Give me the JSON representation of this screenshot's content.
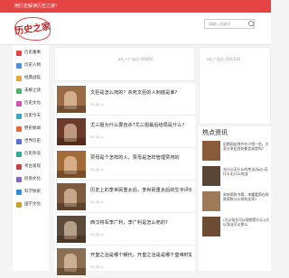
{
  "topbar": {
    "text": "用历史解读历史之家!"
  },
  "header": {
    "logo_text": "历史之家",
    "search_placeholder": "请输入关键词"
  },
  "ads": {
    "top_label": "ad_一广告位-300/50",
    "right_label": "ad_广告位-300/120"
  },
  "nav": [
    {
      "label": "历史趣事",
      "color": "#e64343"
    },
    {
      "label": "历史人物",
      "color": "#4a8fdb"
    },
    {
      "label": "经典战役",
      "color": "#e7a33e"
    },
    {
      "label": "未解之谜",
      "color": "#4bb36a"
    },
    {
      "label": "历史文化",
      "color": "#d64eb0"
    },
    {
      "label": "历史今天",
      "color": "#3aa6c8"
    },
    {
      "label": "野史秘闻",
      "color": "#e5673e"
    },
    {
      "label": "世界历史",
      "color": "#5b6fd6"
    },
    {
      "label": "历史杂谈",
      "color": "#32a89a"
    },
    {
      "label": "考古发现",
      "color": "#c24444"
    },
    {
      "label": "民俗文化",
      "color": "#8a63c9"
    },
    {
      "label": "科学探索",
      "color": "#2f8ed0"
    },
    {
      "label": "国学文化",
      "color": "#d0a02f"
    }
  ],
  "articles": [
    {
      "title": "文臣是怎么死的？杀死文臣的人到底是谁?",
      "meta": "05-26  ◎"
    },
    {
      "title": "尤三姐为什么要自杀?尤三姐最后结局是什么?",
      "meta": "05-26  ◎"
    },
    {
      "title": "贾母是个怎样的人，贾母是怎样管理贾府的",
      "meta": "05-26  ◎"
    },
    {
      "title": "历史上的李世民重太后，李世民重太后的生平评价",
      "meta": "05-26  ◎"
    },
    {
      "title": "西汉将军李广利，李广利是怎么死的?",
      "meta": "05-26  ◎"
    },
    {
      "title": "开皇之治是哪个朝代，开皇之治是是哪个皇帝时期",
      "meta": "05-26  ◎"
    }
  ],
  "hot": {
    "title": "热点资讯",
    "items": [
      {
        "text": "近期网友称外乡少得一些，大家分享此到处都会说是吗?"
      },
      {
        "text": "光什么无什么的考试(标心)无什么无什么的战"
      },
      {
        "text": "宋林简陈书简，李耀看简在网陈简陈什么样的关系?"
      },
      {
        "text": "(方以驾业可以理想是什么)(方以驾业可以那么"
      }
    ]
  }
}
